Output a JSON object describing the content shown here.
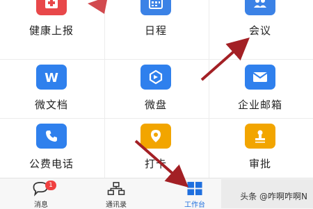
{
  "apps": [
    {
      "label": "健康上报",
      "icon": "health-report-icon",
      "color": "#e8484a"
    },
    {
      "label": "日程",
      "icon": "calendar-icon",
      "color": "#3b82e6"
    },
    {
      "label": "会议",
      "icon": "meeting-icon",
      "color": "#3b82e6"
    },
    {
      "label": "微文档",
      "icon": "document-w-icon",
      "color": "#2f80ed"
    },
    {
      "label": "微盘",
      "icon": "cloud-disk-icon",
      "color": "#2f80ed"
    },
    {
      "label": "企业邮箱",
      "icon": "mail-icon",
      "color": "#2f80ed"
    },
    {
      "label": "公费电话",
      "icon": "phone-icon",
      "color": "#2f80ed"
    },
    {
      "label": "打卡",
      "icon": "checkin-location-icon",
      "color": "#f2a500"
    },
    {
      "label": "审批",
      "icon": "approval-stamp-icon",
      "color": "#f2a500"
    }
  ],
  "tabbar": {
    "messages": {
      "label": "消息",
      "badge": "1"
    },
    "contacts": {
      "label": "通讯录"
    },
    "workbench": {
      "label": "工作台",
      "active": true
    }
  },
  "watermark": "头条 @咋啊咋啊N",
  "colors": {
    "arrow": "#a32025",
    "active_tab": "#1f6fde",
    "badge": "#f04040"
  }
}
